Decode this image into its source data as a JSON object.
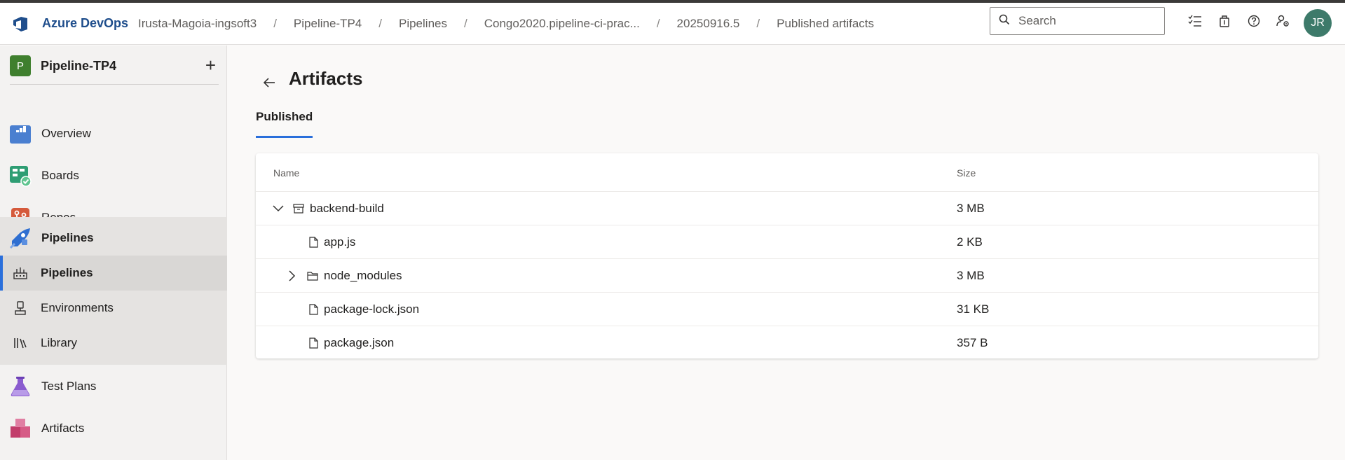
{
  "header": {
    "brand": "Azure DevOps",
    "breadcrumbs": [
      "Irusta-Magoia-ingsoft3",
      "Pipeline-TP4",
      "Pipelines",
      "Congo2020.pipeline-ci-prac...",
      "20250916.5",
      "Published artifacts"
    ],
    "search_placeholder": "Search",
    "icons": [
      "task-list-icon",
      "shopping-bag-icon",
      "help-icon",
      "user-settings-icon"
    ],
    "avatar_initials": "JR"
  },
  "sidebar": {
    "project_initial": "P",
    "project_name": "Pipeline-TP4",
    "items": [
      {
        "label": "Overview",
        "icon": "overview-icon"
      },
      {
        "label": "Boards",
        "icon": "boards-icon"
      },
      {
        "label": "Repos",
        "icon": "repos-icon"
      },
      {
        "label": "Pipelines",
        "icon": "pipelines-icon"
      },
      {
        "label": "Pipelines",
        "icon": "pipelines-sub-icon"
      },
      {
        "label": "Environments",
        "icon": "environments-icon"
      },
      {
        "label": "Library",
        "icon": "library-icon"
      },
      {
        "label": "Test Plans",
        "icon": "test-plans-icon"
      },
      {
        "label": "Artifacts",
        "icon": "artifacts-icon"
      }
    ]
  },
  "main": {
    "title": "Artifacts",
    "tab": "Published",
    "table": {
      "columns": [
        "Name",
        "Size"
      ],
      "rows": [
        {
          "name": "backend-build",
          "size": "3 MB",
          "type": "artifact",
          "expanded": true
        },
        {
          "name": "app.js",
          "size": "2 KB",
          "type": "file"
        },
        {
          "name": "node_modules",
          "size": "3 MB",
          "type": "folder",
          "expanded": false
        },
        {
          "name": "package-lock.json",
          "size": "31 KB",
          "type": "file"
        },
        {
          "name": "package.json",
          "size": "357 B",
          "type": "file"
        }
      ]
    }
  },
  "colors": {
    "accent": "#2a6fdb",
    "project_badge": "#3f7f2e",
    "avatar": "#3d7a6a"
  }
}
